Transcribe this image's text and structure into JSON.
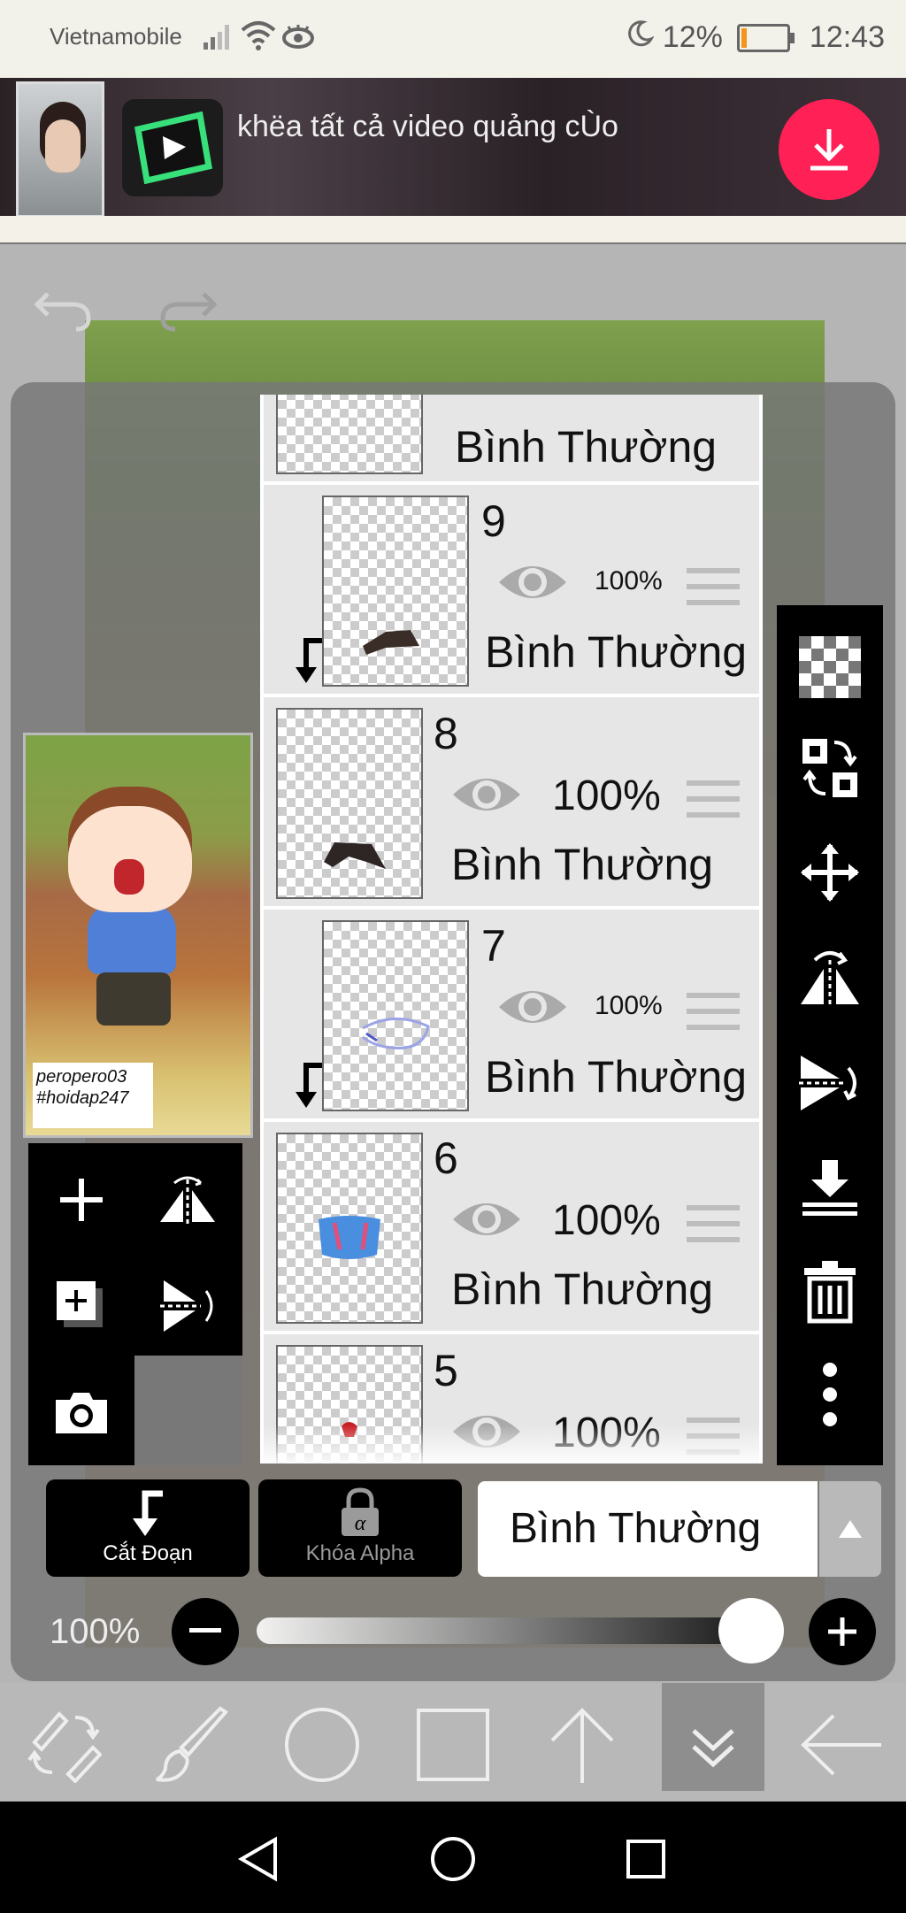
{
  "status_bar": {
    "carrier": "Vietnamobile",
    "battery": "12%",
    "battery_level": 0.12,
    "time": "12:43"
  },
  "ad": {
    "text": "khëa tất cả video quảng cÙo"
  },
  "preview": {
    "signature_line1": "peropero03",
    "signature_line2": "#hoidap247"
  },
  "layers": [
    {
      "number": "",
      "mode": "Bình Thường",
      "opacity": "",
      "clipped": false
    },
    {
      "number": "9",
      "mode": "Bình Thường",
      "opacity": "100%",
      "clipped": true
    },
    {
      "number": "8",
      "mode": "Bình Thường",
      "opacity": "100%",
      "clipped": false
    },
    {
      "number": "7",
      "mode": "Bình Thường",
      "opacity": "100%",
      "clipped": true
    },
    {
      "number": "6",
      "mode": "Bình Thường",
      "opacity": "100%",
      "clipped": false
    },
    {
      "number": "5",
      "mode": "",
      "opacity": "100%",
      "clipped": false
    }
  ],
  "buttons": {
    "cut_label": "Cắt Đoạn",
    "alpha_lock_label": "Khóa Alpha"
  },
  "blend_mode": {
    "value": "Bình Thường"
  },
  "opacity": {
    "label": "100%",
    "value": 1.0
  },
  "icons": {
    "left_tools": [
      "add-layer-icon",
      "flip-horizontal-icon",
      "add-layer-copy-icon",
      "flip-vertical-icon",
      "camera-icon"
    ],
    "right_tools": [
      "transparency-checker-icon",
      "swap-layers-icon",
      "move-icon",
      "flip-horizontal-icon",
      "flip-vertical-icon",
      "merge-down-icon",
      "trash-icon",
      "more-vertical-icon"
    ],
    "toolbar": [
      "transform-tools-icon",
      "brush-icon",
      "circle-icon",
      "square-icon",
      "arrow-up-icon",
      "double-chevron-down-icon",
      "arrow-back-icon"
    ],
    "navigation": [
      "back-triangle-icon",
      "home-circle-icon",
      "recents-square-icon"
    ]
  },
  "colors": {
    "ad_download": "#ff2056",
    "battery_low": "#f3941c",
    "panel_black": "#000000"
  }
}
